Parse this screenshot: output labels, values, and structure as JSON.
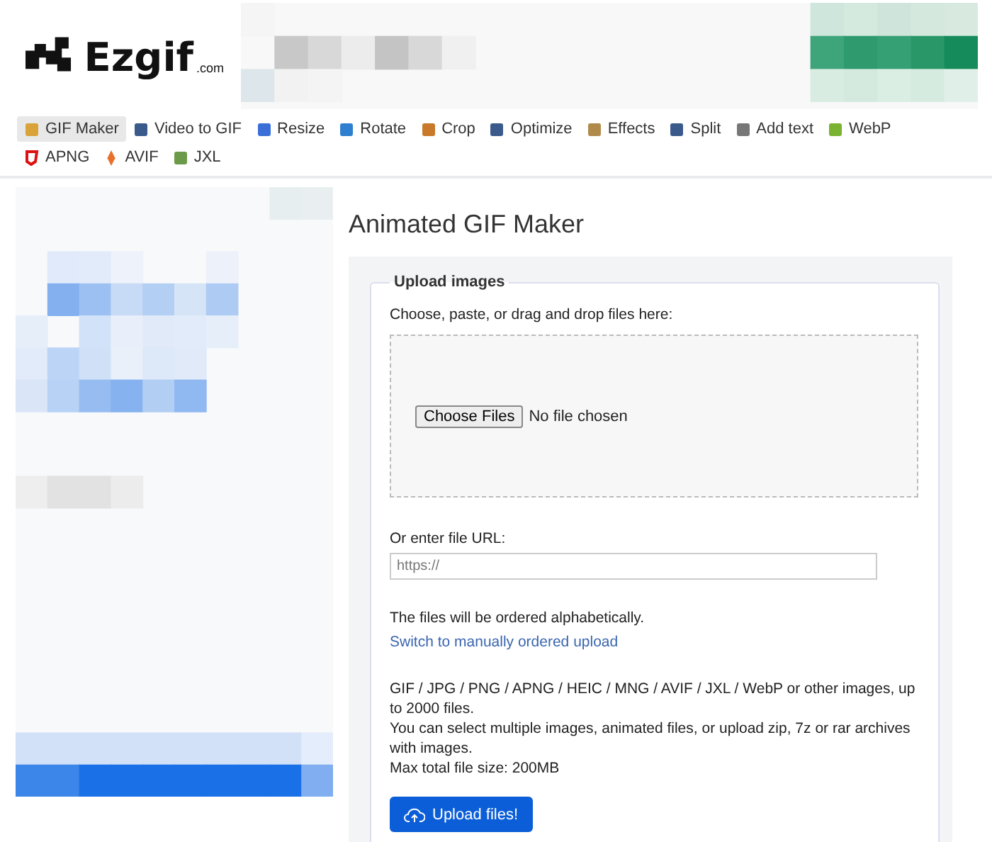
{
  "logo": {
    "name": "Ezgif",
    "suffix": ".com"
  },
  "nav": [
    {
      "label": "GIF Maker",
      "selected": true
    },
    {
      "label": "Video to GIF",
      "selected": false
    },
    {
      "label": "Resize",
      "selected": false
    },
    {
      "label": "Rotate",
      "selected": false
    },
    {
      "label": "Crop",
      "selected": false
    },
    {
      "label": "Optimize",
      "selected": false
    },
    {
      "label": "Effects",
      "selected": false
    },
    {
      "label": "Split",
      "selected": false
    },
    {
      "label": "Add text",
      "selected": false
    },
    {
      "label": "WebP",
      "selected": false
    },
    {
      "label": "APNG",
      "selected": false
    },
    {
      "label": "AVIF",
      "selected": false
    },
    {
      "label": "JXL",
      "selected": false
    }
  ],
  "page_title": "Animated GIF Maker",
  "upload": {
    "legend": "Upload images",
    "drop_label": "Choose, paste, or drag and drop files here:",
    "choose_button": "Choose Files",
    "file_status": "No file chosen",
    "url_label": "Or enter file URL:",
    "url_placeholder": "https://",
    "order_note": "The files will be ordered alphabetically.",
    "order_link": "Switch to manually ordered upload",
    "info": [
      "GIF / JPG / PNG / APNG / HEIC / MNG / AVIF / JXL / WebP or other images, up to 2000 files.",
      "You can select multiple images, animated files, or upload zip, 7z or rar archives with images.",
      "Max total file size: 200MB"
    ],
    "submit": "Upload files!"
  }
}
